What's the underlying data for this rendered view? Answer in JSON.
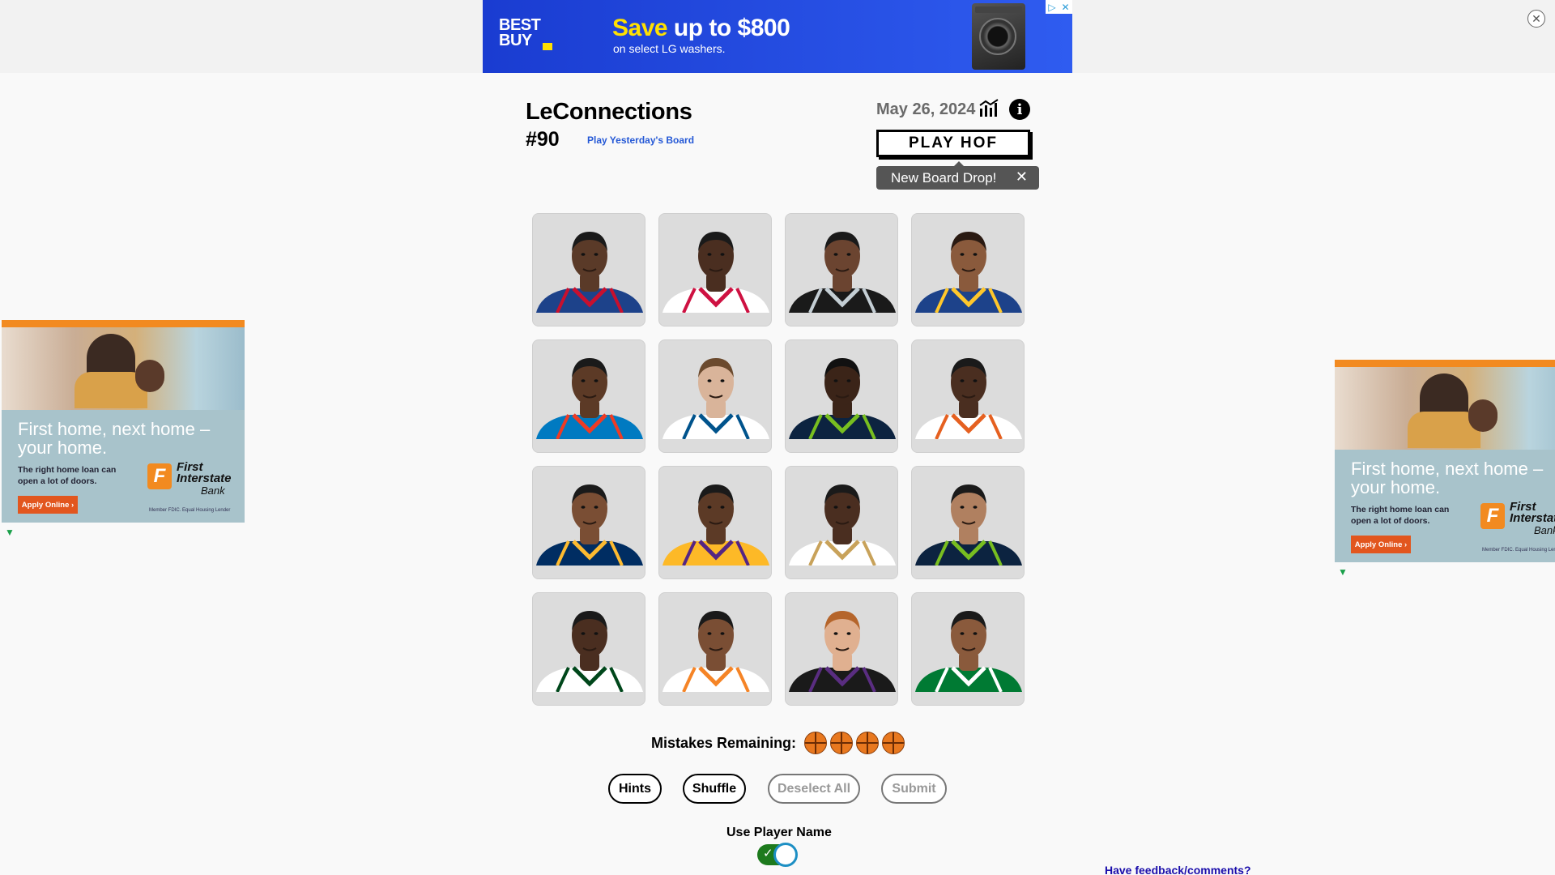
{
  "top_ad": {
    "brand_line1": "BEST",
    "brand_line2": "BUY",
    "headline_highlight": "Save",
    "headline_rest": " up to $800",
    "subline": "on select LG washers.",
    "adchoices_icon": "adchoices-icon",
    "close_icon": "close-icon"
  },
  "header": {
    "title": "LeConnections",
    "board_number": "#90",
    "yesterday_link": "Play Yesterday's Board",
    "date": "May 26, 2024",
    "stats_icon": "bar-chart-icon",
    "info_icon": "info-icon",
    "info_glyph": "i",
    "play_hof_label": "PLAY HOF",
    "tooltip_text": "New Board Drop!",
    "tooltip_close": "✕"
  },
  "players": [
    {
      "id": "p1",
      "jersey": "#1d428a",
      "trim": "#c8102e",
      "skin": "#5a3a28",
      "hair": "#1a1a1a"
    },
    {
      "id": "p2",
      "jersey": "#ffffff",
      "trim": "#ce1141",
      "skin": "#4a2e20",
      "hair": "#1a1a1a"
    },
    {
      "id": "p3",
      "jersey": "#1a1a1a",
      "trim": "#c4ced4",
      "skin": "#6b4430",
      "hair": "#1a1a1a"
    },
    {
      "id": "p4",
      "jersey": "#1d428a",
      "trim": "#ffc72c",
      "skin": "#8a5a3c",
      "hair": "#2a1a12"
    },
    {
      "id": "p5",
      "jersey": "#007ac1",
      "trim": "#ef3b24",
      "skin": "#5c3a26",
      "hair": "#1a1a1a"
    },
    {
      "id": "p6",
      "jersey": "#ffffff",
      "trim": "#00538c",
      "skin": "#d9b49a",
      "hair": "#6b4a2e"
    },
    {
      "id": "p7",
      "jersey": "#0c2340",
      "trim": "#78be20",
      "skin": "#3b2418",
      "hair": "#111111"
    },
    {
      "id": "p8",
      "jersey": "#ffffff",
      "trim": "#e56020",
      "skin": "#4a2e20",
      "hair": "#1a1a1a"
    },
    {
      "id": "p9",
      "jersey": "#002d62",
      "trim": "#fdbb30",
      "skin": "#7a4e34",
      "hair": "#1a1a1a"
    },
    {
      "id": "p10",
      "jersey": "#fdb927",
      "trim": "#552583",
      "skin": "#5c3a26",
      "hair": "#1a1a1a"
    },
    {
      "id": "p11",
      "jersey": "#ffffff",
      "trim": "#c8a25a",
      "skin": "#4a2e20",
      "hair": "#1a1a1a"
    },
    {
      "id": "p12",
      "jersey": "#0c2340",
      "trim": "#78be20",
      "skin": "#b08060",
      "hair": "#1a1a1a"
    },
    {
      "id": "p13",
      "jersey": "#ffffff",
      "trim": "#00471b",
      "skin": "#4a2e20",
      "hair": "#1a1a1a"
    },
    {
      "id": "p14",
      "jersey": "#ffffff",
      "trim": "#f58426",
      "skin": "#7a4e34",
      "hair": "#1a1a1a"
    },
    {
      "id": "p15",
      "jersey": "#1a1a1a",
      "trim": "#5a2d81",
      "skin": "#e0b090",
      "hair": "#b5652b"
    },
    {
      "id": "p16",
      "jersey": "#007a33",
      "trim": "#ffffff",
      "skin": "#8a5a3c",
      "hair": "#1a1a1a"
    }
  ],
  "mistakes": {
    "label": "Mistakes Remaining:",
    "remaining": 4,
    "icon": "basketball-icon"
  },
  "buttons": {
    "hints": "Hints",
    "shuffle": "Shuffle",
    "deselect_all": "Deselect All",
    "submit": "Submit"
  },
  "use_player_name": {
    "label": "Use Player Name",
    "enabled": true,
    "check_glyph": "✓"
  },
  "feedback_link": "Have feedback/comments?",
  "side_ad": {
    "headline": "First home, next home – your home.",
    "sub": "The right home loan can open a lot of doors.",
    "apply": "Apply Online ›",
    "bank_mark": "F",
    "bank_name": "First Interstate",
    "bank_name2": "Bank",
    "fdic": "Member FDIC. Equal Housing Lender",
    "ad_mark_icon": "freestar-icon"
  },
  "colors": {
    "background": "#f9f9f9",
    "link_blue": "#2458d6",
    "toggle_on": "#1d7a1d",
    "ball_orange": "#e8781f",
    "ad_blue": "#1a3cd1"
  }
}
